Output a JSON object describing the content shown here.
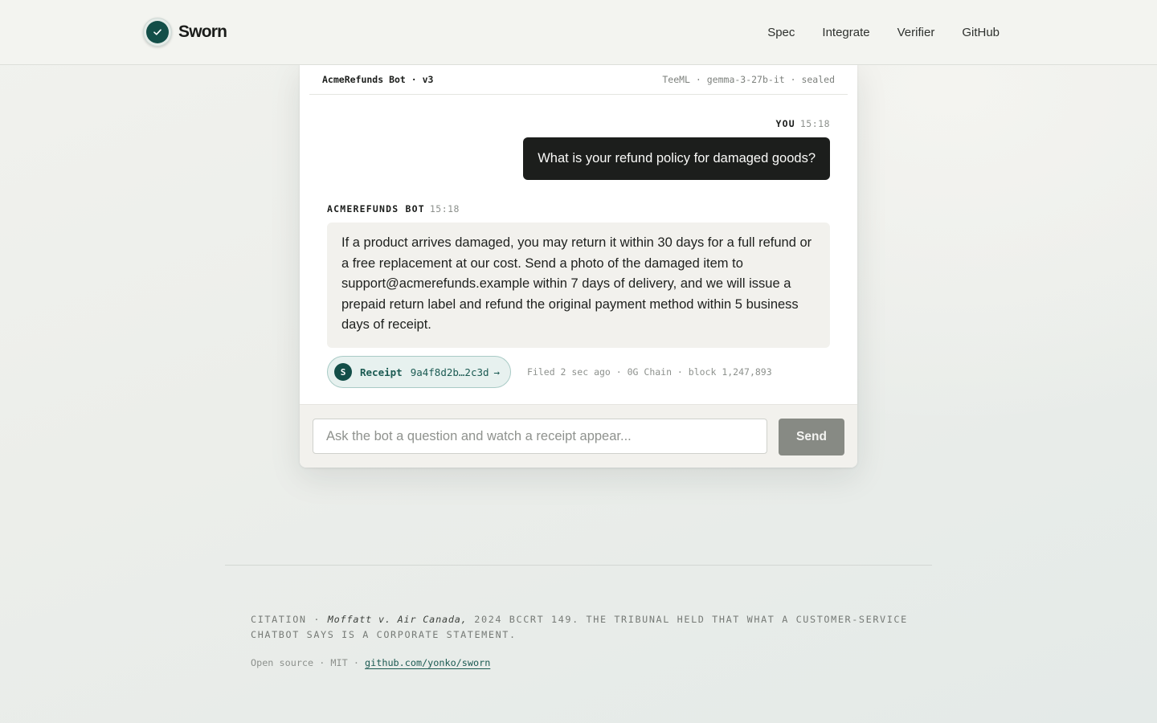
{
  "header": {
    "brand": "Sworn",
    "nav": [
      "Spec",
      "Integrate",
      "Verifier",
      "GitHub"
    ]
  },
  "chat": {
    "bot_title": "AcmeRefunds Bot · v3",
    "model_info": "TeeML · gemma-3-27b-it · sealed",
    "user_sender": "YOU",
    "user_time": "15:18",
    "user_message": "What is your refund policy for damaged goods?",
    "bot_sender": "ACMEREFUNDS BOT",
    "bot_time": "15:18",
    "bot_message": "If a product arrives damaged, you may return it within 30 days for a full refund or a free replacement at our cost. Send a photo of the damaged item to support@acmerefunds.example within 7 days of delivery, and we will issue a prepaid return label and refund the original payment method within 5 business days of receipt.",
    "receipt": {
      "badge": "S",
      "label": "Receipt",
      "hash": "9a4f8d2b…2c3d",
      "arrow": "→"
    },
    "filed_info": "Filed 2 sec ago · 0G Chain · block 1,247,893",
    "input_placeholder": "Ask the bot a question and watch a receipt appear...",
    "send_label": "Send"
  },
  "footer": {
    "citation_prefix": "Citation · ",
    "citation_case": "Moffatt v. Air Canada,",
    "citation_rest": " 2024 BCCRT 149. The tribunal held that what a customer-service chatbot says is a corporate statement.",
    "license_text": "Open source · MIT · ",
    "repo_link": "github.com/yonko/sworn"
  },
  "colors": {
    "brand_teal": "#134e48",
    "user_bubble": "#1c1e1c",
    "bot_bubble": "#f2f1ed",
    "send_button": "#878a84"
  },
  "icons": {
    "logo": "check-icon",
    "receipt_arrow": "arrow-right-icon"
  }
}
